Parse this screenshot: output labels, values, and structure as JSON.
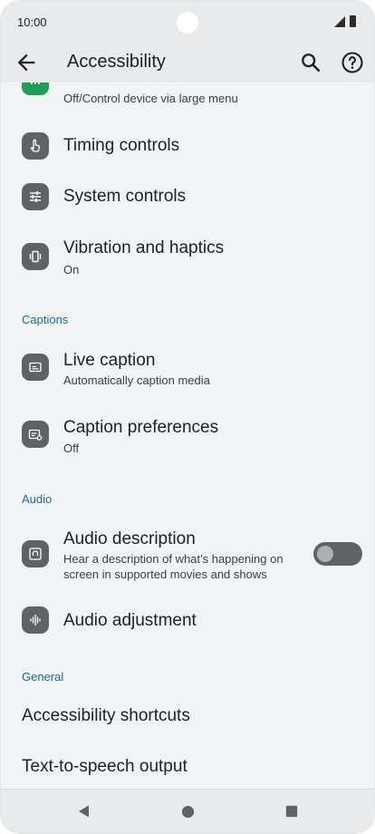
{
  "status_bar": {
    "time": "10:00"
  },
  "app_bar": {
    "title": "Accessibility"
  },
  "items": {
    "menu": {
      "subtitle": "Off/Control device via large menu"
    },
    "timing": {
      "title": "Timing controls"
    },
    "system": {
      "title": "System controls"
    },
    "vibration": {
      "title": "Vibration and haptics",
      "subtitle": "On"
    },
    "live_caption": {
      "title": "Live caption",
      "subtitle": "Automatically caption media"
    },
    "caption_prefs": {
      "title": "Caption preferences",
      "subtitle": "Off"
    },
    "audio_desc": {
      "title": "Audio description",
      "subtitle_line1": "Hear a description of what’s happening on",
      "subtitle_line2": "screen in supported movies and shows",
      "enabled": false
    },
    "audio_adj": {
      "title": "Audio adjustment"
    },
    "shortcuts": {
      "title": "Accessibility shortcuts"
    },
    "tts": {
      "title": "Text-to-speech output"
    }
  },
  "sections": {
    "captions": "Captions",
    "audio": "Audio",
    "general": "General"
  },
  "colors": {
    "accent": "#1c6d84",
    "icon_bg": "#5f6368",
    "menu_icon_bg": "#1e9e58"
  }
}
